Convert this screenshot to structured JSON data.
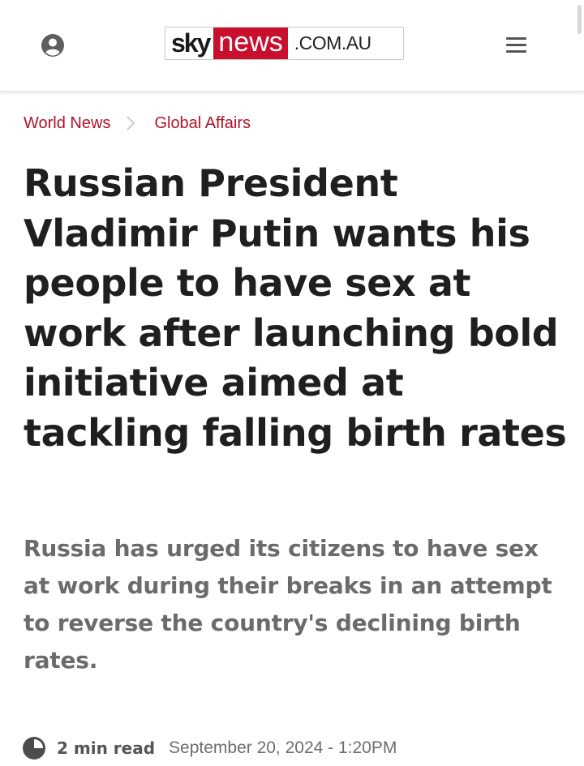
{
  "header": {
    "logo": {
      "sky": "sky",
      "news": "news",
      "domain": ".COM.AU",
      "brand_red": "#c8102e"
    },
    "account_icon": "user-circle-icon",
    "menu_icon": "hamburger-menu-icon"
  },
  "breadcrumb": {
    "items": [
      {
        "label": "World News"
      },
      {
        "label": "Global Affairs"
      }
    ],
    "separator_icon": "chevron-right-icon",
    "link_color": "#b3122a"
  },
  "article": {
    "headline": "Russian President Vladimir Putin wants his people to have sex at work after launching bold initiative aimed at tackling falling birth rates",
    "standfirst": "Russia has urged its citizens to have sex at work during their breaks in an attempt to reverse the country's declining birth rates.",
    "meta": {
      "clock_icon": "clock-icon",
      "read_time": "2 min read",
      "date": "September 20, 2024 - 1:20PM"
    }
  }
}
